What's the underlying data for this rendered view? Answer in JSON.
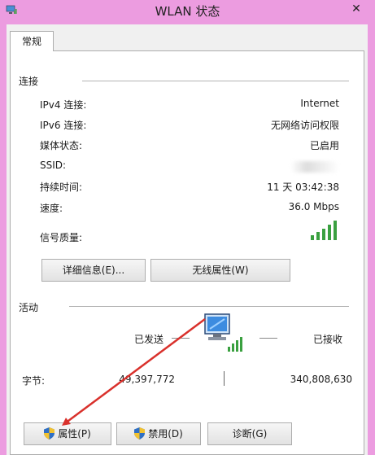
{
  "window": {
    "title": "WLAN 状态",
    "close_glyph": "✕"
  },
  "tabs": [
    {
      "label": "常规",
      "active": true
    }
  ],
  "connection": {
    "group_title": "连接",
    "rows": [
      {
        "label": "IPv4 连接:",
        "value": "Internet"
      },
      {
        "label": "IPv6 连接:",
        "value": "无网络访问权限"
      },
      {
        "label": "媒体状态:",
        "value": "已启用"
      },
      {
        "label": "SSID:",
        "value": ""
      },
      {
        "label": "持续时间:",
        "value": "11 天 03:42:38"
      },
      {
        "label": "速度:",
        "value": "36.0 Mbps"
      },
      {
        "label": "信号质量:",
        "value": ""
      }
    ],
    "signal_bars": 5,
    "signal_color": "#3aa040",
    "details_button": "详细信息(E)...",
    "wireless_props_button": "无线属性(W)"
  },
  "activity": {
    "group_title": "活动",
    "sent_label": "已发送",
    "received_label": "已接收",
    "bytes_label": "字节:",
    "bytes_sent": "49,397,772",
    "bytes_received": "340,808,630"
  },
  "buttons": {
    "properties": "属性(P)",
    "disable": "禁用(D)",
    "diagnose": "诊断(G)"
  },
  "colors": {
    "titlebar": "#ec9ce0",
    "arrow": "#d9312c",
    "shield_blue": "#2f6fc4",
    "shield_yellow": "#f2c230"
  }
}
